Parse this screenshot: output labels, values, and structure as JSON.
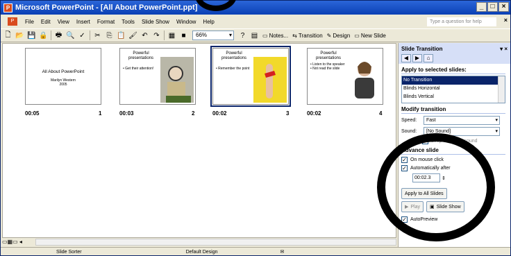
{
  "window": {
    "title": "Microsoft PowerPoint - [All About PowerPoint.ppt]",
    "controls": [
      "_",
      "□",
      "×"
    ]
  },
  "menu": {
    "items": [
      "File",
      "Edit",
      "View",
      "Insert",
      "Format",
      "Tools",
      "Slide Show",
      "Window",
      "Help"
    ],
    "help_placeholder": "Type a question for help"
  },
  "toolbar": {
    "zoom": "66%",
    "notes": "Notes...",
    "transition": "Transition",
    "design": "Design",
    "new_slide": "New Slide"
  },
  "slides": [
    {
      "number": "1",
      "timing": "00:05",
      "title": "All About PowerPoint",
      "sub": "Marilyn Western\n2005"
    },
    {
      "number": "2",
      "timing": "00:03",
      "title": "Powerful presentations",
      "bullet": "• Get their attention!"
    },
    {
      "number": "3",
      "timing": "00:02",
      "title": "Powerful presentations",
      "bullet": "• Remember the point"
    },
    {
      "number": "4",
      "timing": "00:02",
      "title": "Powerful presentations",
      "bullet": "• Listen to the speaker\n• Not read the slide"
    }
  ],
  "taskpane": {
    "title": "Slide Transition",
    "apply_label": "Apply to selected slides:",
    "transitions": [
      "No Transition",
      "Blinds Horizontal",
      "Blinds Vertical"
    ],
    "modify_label": "Modify transition",
    "speed_label": "Speed:",
    "speed_value": "Fast",
    "sound_label": "Sound:",
    "sound_value": "[No Sound]",
    "loop_label": "Loop until next sound",
    "advance_label": "Advance slide",
    "on_click_label": "On mouse click",
    "auto_label": "Automatically after",
    "auto_value": "00:02.3",
    "apply_all": "Apply to All Slides",
    "play": "Play",
    "slide_show": "Slide Show",
    "autopreview": "AutoPreview"
  },
  "status": {
    "view": "Slide Sorter",
    "design": "Default Design"
  }
}
